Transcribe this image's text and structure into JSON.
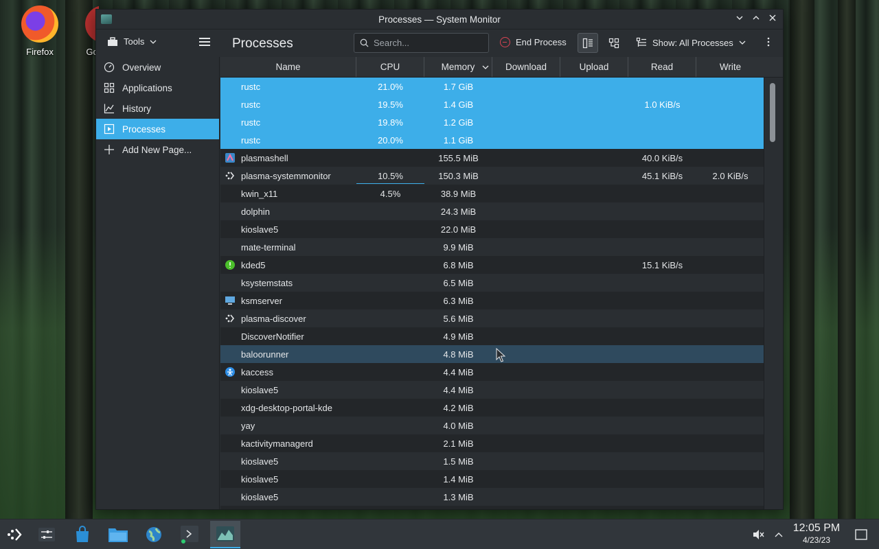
{
  "desktop": {
    "icons": [
      {
        "label": "Firefox"
      },
      {
        "label": "Go"
      }
    ]
  },
  "window": {
    "title": "Processes — System Monitor",
    "controls": {
      "minimize": "⌵",
      "maximize": "⌃",
      "close": "✕"
    }
  },
  "toolbar": {
    "tools_label": "Tools",
    "page_title": "Processes",
    "search_placeholder": "Search...",
    "end_process_label": "End Process",
    "show_label": "Show: All Processes"
  },
  "sidebar": {
    "items": [
      {
        "label": "Overview",
        "icon": "gauge-icon"
      },
      {
        "label": "Applications",
        "icon": "grid-icon"
      },
      {
        "label": "History",
        "icon": "chart-icon"
      },
      {
        "label": "Processes",
        "icon": "process-icon",
        "active": true
      },
      {
        "label": "Add New Page...",
        "icon": "plus-icon"
      }
    ]
  },
  "table": {
    "columns": [
      "Name",
      "CPU",
      "Memory",
      "Download",
      "Upload",
      "Read",
      "Write"
    ],
    "rows": [
      {
        "name": "rustc",
        "cpu": "21.0%",
        "mem": "1.7 GiB",
        "dl": "",
        "ul": "",
        "rd": "",
        "wr": "",
        "state": "sel",
        "icon": ""
      },
      {
        "name": "rustc",
        "cpu": "19.5%",
        "mem": "1.4 GiB",
        "dl": "",
        "ul": "",
        "rd": "1.0 KiB/s",
        "wr": "",
        "state": "sel",
        "icon": ""
      },
      {
        "name": "rustc",
        "cpu": "19.8%",
        "mem": "1.2 GiB",
        "dl": "",
        "ul": "",
        "rd": "",
        "wr": "",
        "state": "sel",
        "icon": ""
      },
      {
        "name": "rustc",
        "cpu": "20.0%",
        "mem": "1.1 GiB",
        "dl": "",
        "ul": "",
        "rd": "",
        "wr": "",
        "state": "sel",
        "icon": ""
      },
      {
        "name": "plasmashell",
        "cpu": "",
        "mem": "155.5 MiB",
        "dl": "",
        "ul": "",
        "rd": "40.0 KiB/s",
        "wr": "",
        "state": "",
        "icon": "plasma"
      },
      {
        "name": "plasma-systemmonitor",
        "cpu": "10.5%",
        "mem": "150.3 MiB",
        "dl": "",
        "ul": "",
        "rd": "45.1 KiB/s",
        "wr": "2.0 KiB/s",
        "state": "alt",
        "icon": "spinner",
        "cpu_bar": 1.0
      },
      {
        "name": "kwin_x11",
        "cpu": "4.5%",
        "mem": "38.9 MiB",
        "dl": "",
        "ul": "",
        "rd": "",
        "wr": "",
        "state": "",
        "icon": ""
      },
      {
        "name": "dolphin",
        "cpu": "",
        "mem": "24.3 MiB",
        "dl": "",
        "ul": "",
        "rd": "",
        "wr": "",
        "state": "alt",
        "icon": ""
      },
      {
        "name": "kioslave5",
        "cpu": "",
        "mem": "22.0 MiB",
        "dl": "",
        "ul": "",
        "rd": "",
        "wr": "",
        "state": "",
        "icon": ""
      },
      {
        "name": "mate-terminal",
        "cpu": "",
        "mem": "9.9 MiB",
        "dl": "",
        "ul": "",
        "rd": "",
        "wr": "",
        "state": "alt",
        "icon": ""
      },
      {
        "name": "kded5",
        "cpu": "",
        "mem": "6.8 MiB",
        "dl": "",
        "ul": "",
        "rd": "15.1 KiB/s",
        "wr": "",
        "state": "",
        "icon": "green"
      },
      {
        "name": "ksystemstats",
        "cpu": "",
        "mem": "6.5 MiB",
        "dl": "",
        "ul": "",
        "rd": "",
        "wr": "",
        "state": "alt",
        "icon": ""
      },
      {
        "name": "ksmserver",
        "cpu": "",
        "mem": "6.3 MiB",
        "dl": "",
        "ul": "",
        "rd": "",
        "wr": "",
        "state": "",
        "icon": "monitor"
      },
      {
        "name": "plasma-discover",
        "cpu": "",
        "mem": "5.6 MiB",
        "dl": "",
        "ul": "",
        "rd": "",
        "wr": "",
        "state": "alt",
        "icon": "spinner"
      },
      {
        "name": "DiscoverNotifier",
        "cpu": "",
        "mem": "4.9 MiB",
        "dl": "",
        "ul": "",
        "rd": "",
        "wr": "",
        "state": "",
        "icon": ""
      },
      {
        "name": "baloorunner",
        "cpu": "",
        "mem": "4.8 MiB",
        "dl": "",
        "ul": "",
        "rd": "",
        "wr": "",
        "state": "hover",
        "icon": ""
      },
      {
        "name": "kaccess",
        "cpu": "",
        "mem": "4.4 MiB",
        "dl": "",
        "ul": "",
        "rd": "",
        "wr": "",
        "state": "",
        "icon": "blue"
      },
      {
        "name": "kioslave5",
        "cpu": "",
        "mem": "4.4 MiB",
        "dl": "",
        "ul": "",
        "rd": "",
        "wr": "",
        "state": "alt",
        "icon": ""
      },
      {
        "name": "xdg-desktop-portal-kde",
        "cpu": "",
        "mem": "4.2 MiB",
        "dl": "",
        "ul": "",
        "rd": "",
        "wr": "",
        "state": "",
        "icon": ""
      },
      {
        "name": "yay",
        "cpu": "",
        "mem": "4.0 MiB",
        "dl": "",
        "ul": "",
        "rd": "",
        "wr": "",
        "state": "alt",
        "icon": ""
      },
      {
        "name": "kactivitymanagerd",
        "cpu": "",
        "mem": "2.1 MiB",
        "dl": "",
        "ul": "",
        "rd": "",
        "wr": "",
        "state": "",
        "icon": ""
      },
      {
        "name": "kioslave5",
        "cpu": "",
        "mem": "1.5 MiB",
        "dl": "",
        "ul": "",
        "rd": "",
        "wr": "",
        "state": "alt",
        "icon": ""
      },
      {
        "name": "kioslave5",
        "cpu": "",
        "mem": "1.4 MiB",
        "dl": "",
        "ul": "",
        "rd": "",
        "wr": "",
        "state": "",
        "icon": ""
      },
      {
        "name": "kioslave5",
        "cpu": "",
        "mem": "1.3 MiB",
        "dl": "",
        "ul": "",
        "rd": "",
        "wr": "",
        "state": "alt",
        "icon": ""
      }
    ]
  },
  "taskbar": {
    "clock_time": "12:05 PM",
    "clock_date": "4/23/23"
  },
  "colors": {
    "accent": "#3daee9",
    "window_bg": "#2a2e32",
    "table_bg": "#232629",
    "hover_row": "#2f4a5e"
  }
}
